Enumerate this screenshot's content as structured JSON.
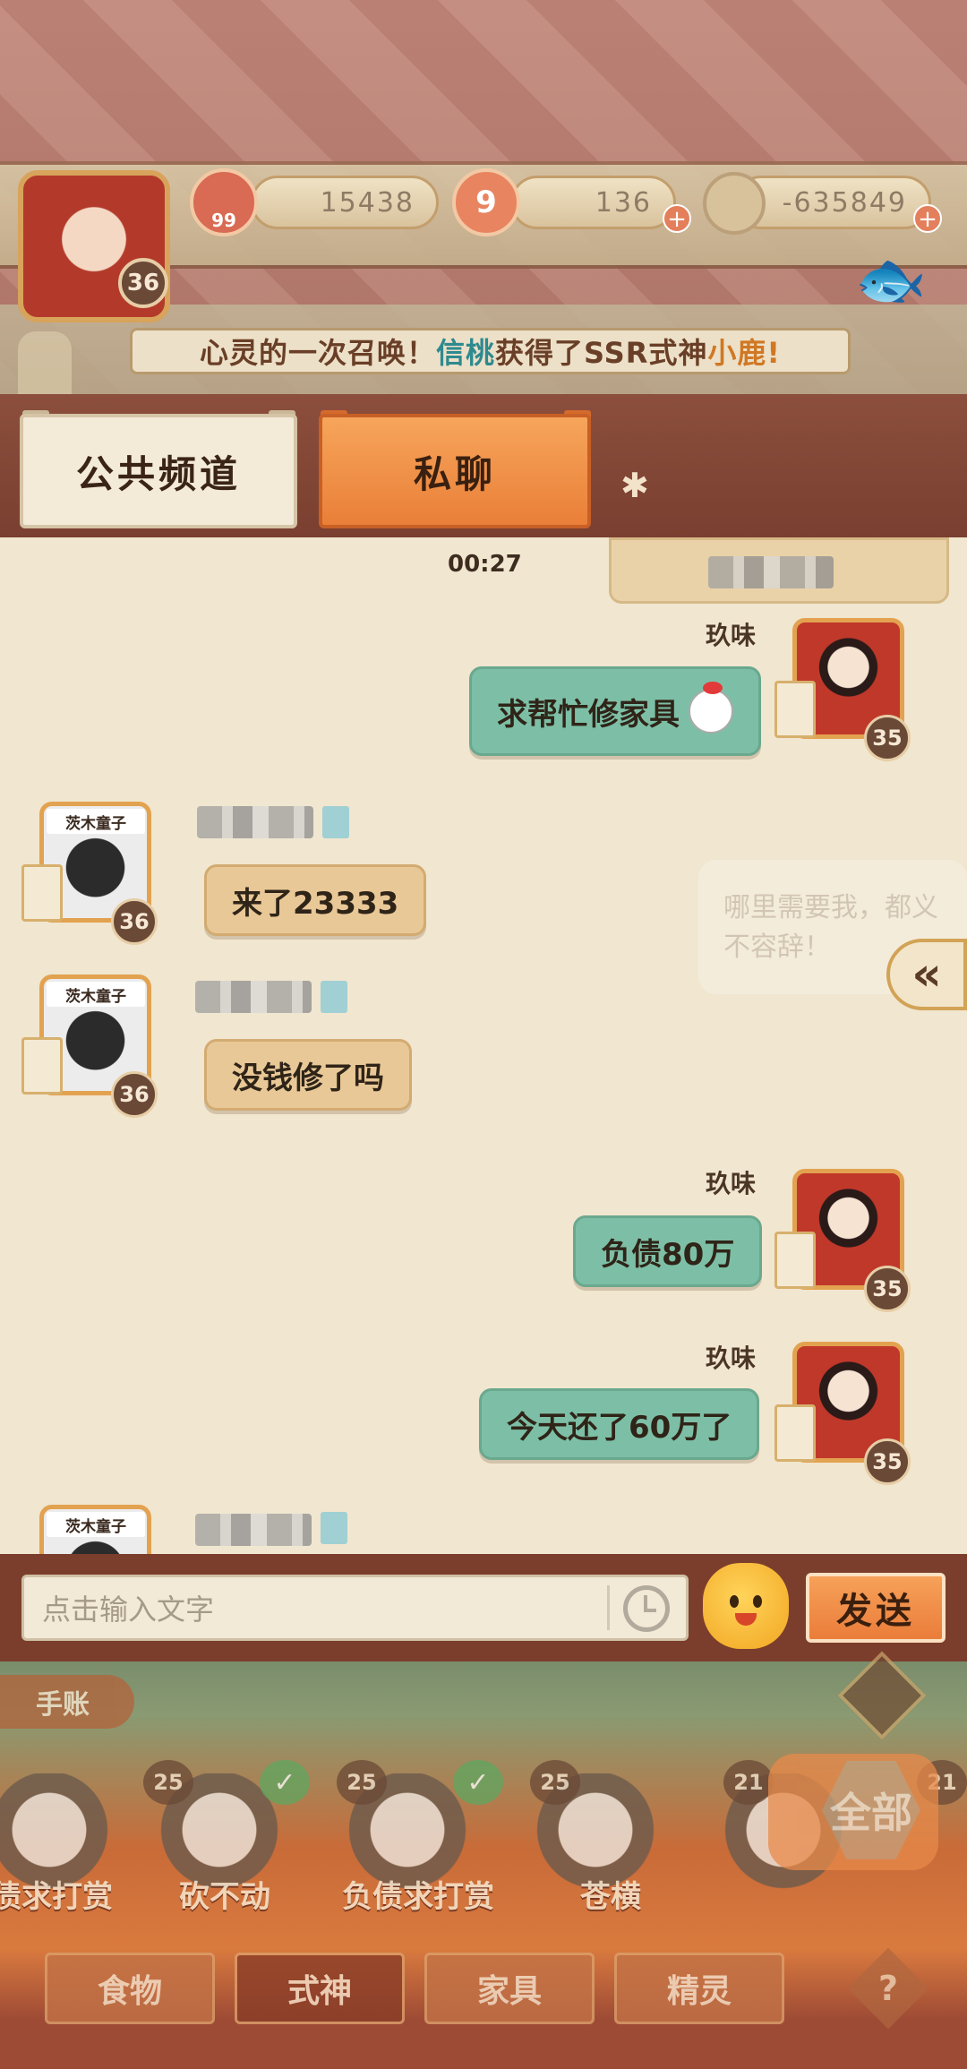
{
  "resources": {
    "gold_cherry": "15438",
    "magatama": "136",
    "coins": "-635849",
    "player_level": "36",
    "gold_icon_sub": "99",
    "magatama_icon": "9"
  },
  "announcement": {
    "prefix": "心灵的一次召唤！",
    "player": "信桃",
    "middle": "获得了SSR式神",
    "shikigami": "小鹿!"
  },
  "tabs": {
    "public": "公共频道",
    "private": "私聊"
  },
  "chat": {
    "timestamp": "00:27",
    "watermark": "哪里需要我，都义不容辞！",
    "messages": [
      {
        "side": "self",
        "sender": "玖味",
        "text": "求帮忙修家具",
        "level": "35"
      },
      {
        "side": "other",
        "nameplate": "茨木童子",
        "text": "来了23333",
        "level": "36"
      },
      {
        "side": "other",
        "nameplate": "茨木童子",
        "text": "没钱修了吗",
        "level": "36"
      },
      {
        "side": "self",
        "sender": "玖味",
        "text": "负债80万",
        "level": "35"
      },
      {
        "side": "self",
        "sender": "玖味",
        "text": "今天还了60万了",
        "level": "35"
      },
      {
        "side": "other",
        "nameplate": "茨木童子",
        "text": "",
        "level": ""
      }
    ]
  },
  "input": {
    "placeholder": "点击输入文字",
    "send_label": "发送"
  },
  "bottom": {
    "journal": "手账",
    "all_label": "全部",
    "shikigami": [
      {
        "name": "债求打赏",
        "level": "",
        "checked": false
      },
      {
        "name": "砍不动",
        "level": "25",
        "checked": true
      },
      {
        "name": "负债求打赏",
        "level": "25",
        "checked": true
      },
      {
        "name": "苍横",
        "level": "25",
        "checked": false
      },
      {
        "name": "",
        "level": "21",
        "checked": false
      },
      {
        "name": "",
        "level": "21",
        "checked": false
      }
    ],
    "categories": [
      "食物",
      "式神",
      "家具",
      "精灵"
    ],
    "help": "?"
  },
  "colors": {
    "self_bubble": "#7dbfa6",
    "other_bubble": "#e9c897",
    "active_tab": "#ea7f38",
    "send_button": "#ea7d3a"
  }
}
